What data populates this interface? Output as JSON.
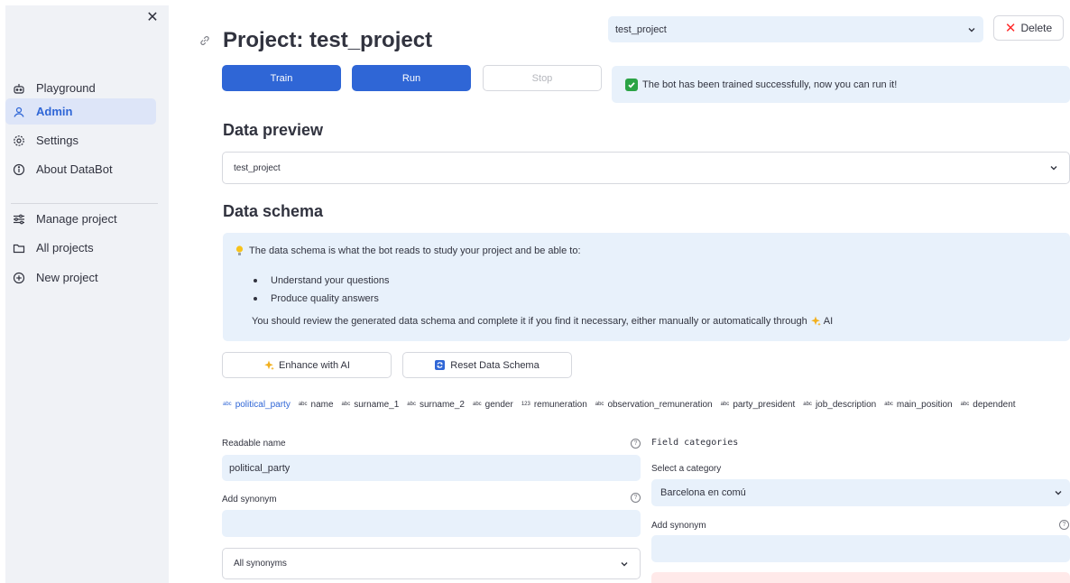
{
  "sidebar": {
    "items": [
      {
        "label": "Playground",
        "icon": "robot-icon"
      },
      {
        "label": "Admin",
        "icon": "user-icon"
      },
      {
        "label": "Settings",
        "icon": "gear-icon"
      },
      {
        "label": "About DataBot",
        "icon": "info-icon"
      }
    ],
    "items2": [
      {
        "label": "Manage project",
        "icon": "sliders-icon"
      },
      {
        "label": "All projects",
        "icon": "folder-icon"
      },
      {
        "label": "New project",
        "icon": "plus-circle-icon"
      }
    ],
    "active": "Admin"
  },
  "header": {
    "title": "Project: test_project",
    "project_select": "test_project",
    "delete_label": "Delete"
  },
  "actions": {
    "train": "Train",
    "run": "Run",
    "stop": "Stop"
  },
  "status": {
    "message": "The bot has been trained successfully, now you can run it!"
  },
  "preview": {
    "heading": "Data preview",
    "selected": "test_project"
  },
  "schema": {
    "heading": "Data schema",
    "info_intro": "The data schema is what the bot reads to study your project and be able to:",
    "bullets": [
      "Understand your questions",
      "Produce quality answers"
    ],
    "info_outro": "You should review the generated data schema and complete it if you find it necessary, either manually or automatically through",
    "info_outro_ai": "AI",
    "enhance_label": "Enhance with AI",
    "reset_label": "Reset Data Schema"
  },
  "tabs": [
    {
      "type": "abc",
      "label": "political_party"
    },
    {
      "type": "abc",
      "label": "name"
    },
    {
      "type": "abc",
      "label": "surname_1"
    },
    {
      "type": "abc",
      "label": "surname_2"
    },
    {
      "type": "abc",
      "label": "gender"
    },
    {
      "type": "123",
      "label": "remuneration"
    },
    {
      "type": "abc",
      "label": "observation_remuneration"
    },
    {
      "type": "abc",
      "label": "party_president"
    },
    {
      "type": "abc",
      "label": "job_description"
    },
    {
      "type": "abc",
      "label": "main_position"
    },
    {
      "type": "abc",
      "label": "dependent"
    }
  ],
  "left_form": {
    "readable_name_label": "Readable name",
    "readable_name_value": "political_party",
    "add_synonym_label": "Add synonym",
    "add_synonym_value": "",
    "all_synonyms": "All synonyms"
  },
  "right_form": {
    "title": "Field categories",
    "select_label": "Select a category",
    "select_value": "Barcelona en comú",
    "add_synonym_label": "Add synonym",
    "add_synonym_value": ""
  },
  "colors": {
    "accent": "#2f66d6",
    "sidebar_bg": "#f0f2f6",
    "field_bg": "#e8f1fb",
    "success": "#2ba345",
    "danger": "#ff2b2b"
  }
}
